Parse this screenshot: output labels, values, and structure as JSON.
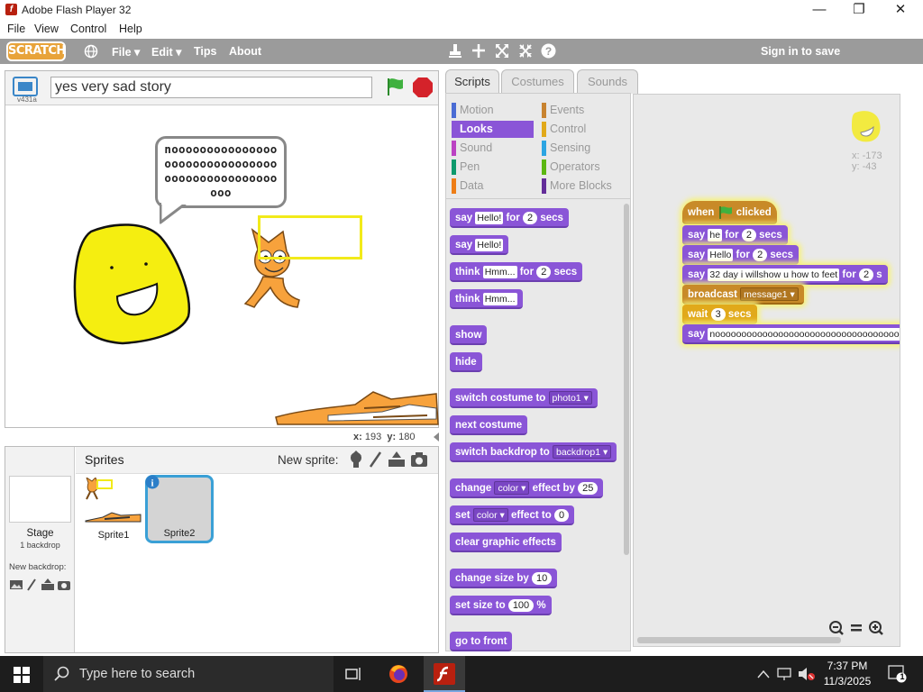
{
  "window": {
    "title": "Adobe Flash Player 32",
    "minimize": "—",
    "maximize": "❐",
    "close": "✕"
  },
  "menubar": [
    "File",
    "View",
    "Control",
    "Help"
  ],
  "scratch": {
    "logo": "SCRATCH",
    "menus": [
      "File ▾",
      "Edit ▾",
      "Tips",
      "About"
    ],
    "signin": "Sign in to save"
  },
  "stage": {
    "project_title": "yes very sad story",
    "version": "v431a",
    "speech": "noooooooooooooooooooooooooooooooooooooooooooooooooo",
    "coords": {
      "x_label": "x:",
      "x": "193",
      "y_label": "y:",
      "y": "180"
    }
  },
  "sprites": {
    "header": "Sprites",
    "new_sprite": "New sprite:",
    "stage_label": "Stage",
    "stage_sub": "1 backdrop",
    "new_backdrop": "New backdrop:",
    "items": [
      "Sprite1",
      "Sprite2"
    ]
  },
  "tabs": [
    "Scripts",
    "Costumes",
    "Sounds"
  ],
  "categories": [
    {
      "label": "Motion",
      "color": "#4a6cd4"
    },
    {
      "label": "Looks",
      "color": "#8a55d7"
    },
    {
      "label": "Sound",
      "color": "#bb42c3"
    },
    {
      "label": "Pen",
      "color": "#0e9a6c"
    },
    {
      "label": "Data",
      "color": "#ee7d16"
    },
    {
      "label": "Events",
      "color": "#c88330"
    },
    {
      "label": "Control",
      "color": "#e1a91a"
    },
    {
      "label": "Sensing",
      "color": "#2ca5e2"
    },
    {
      "label": "Operators",
      "color": "#5cb712"
    },
    {
      "label": "More Blocks",
      "color": "#632d99"
    }
  ],
  "palette": {
    "say_for": {
      "say": "say",
      "text": "Hello!",
      "for": "for",
      "n": "2",
      "secs": "secs"
    },
    "say": {
      "say": "say",
      "text": "Hello!"
    },
    "think_for": {
      "think": "think",
      "text": "Hmm...",
      "for": "for",
      "n": "2",
      "secs": "secs"
    },
    "think": {
      "think": "think",
      "text": "Hmm..."
    },
    "show": "show",
    "hide": "hide",
    "switch_costume": {
      "label": "switch costume to",
      "value": "photo1"
    },
    "next_costume": "next costume",
    "switch_backdrop": {
      "label": "switch backdrop to",
      "value": "backdrop1"
    },
    "change_effect": {
      "change": "change",
      "effect": "color",
      "by": "effect by",
      "n": "25"
    },
    "set_effect": {
      "set": "set",
      "effect": "color",
      "to": "effect to",
      "n": "0"
    },
    "clear_effects": "clear graphic effects",
    "change_size": {
      "label": "change size by",
      "n": "10"
    },
    "set_size": {
      "label": "set size to",
      "n": "100",
      "pct": "%"
    },
    "go_front": "go to front"
  },
  "script": {
    "sprite_x": "x: -173",
    "sprite_y": "y: -43",
    "hat": {
      "when": "when",
      "clicked": "clicked"
    },
    "b1": {
      "say": "say",
      "text": "he",
      "for": "for",
      "n": "2",
      "secs": "secs"
    },
    "b2": {
      "say": "say",
      "text": "Hello",
      "for": "for",
      "n": "2",
      "secs": "secs"
    },
    "b3": {
      "say": "say",
      "text": "32 day i willshow u how to feet",
      "for": "for",
      "n": "2",
      "secs": "s"
    },
    "b4": {
      "broadcast": "broadcast",
      "msg": "message1"
    },
    "b5": {
      "wait": "wait",
      "n": "3",
      "secs": "secs"
    },
    "b6": {
      "say": "say",
      "text": "nooooooooooooooooooooooooooooooooooo"
    }
  },
  "taskbar": {
    "search": "Type here to search",
    "time": "7:37 PM",
    "date": "11/3/2025",
    "notif": "1"
  }
}
